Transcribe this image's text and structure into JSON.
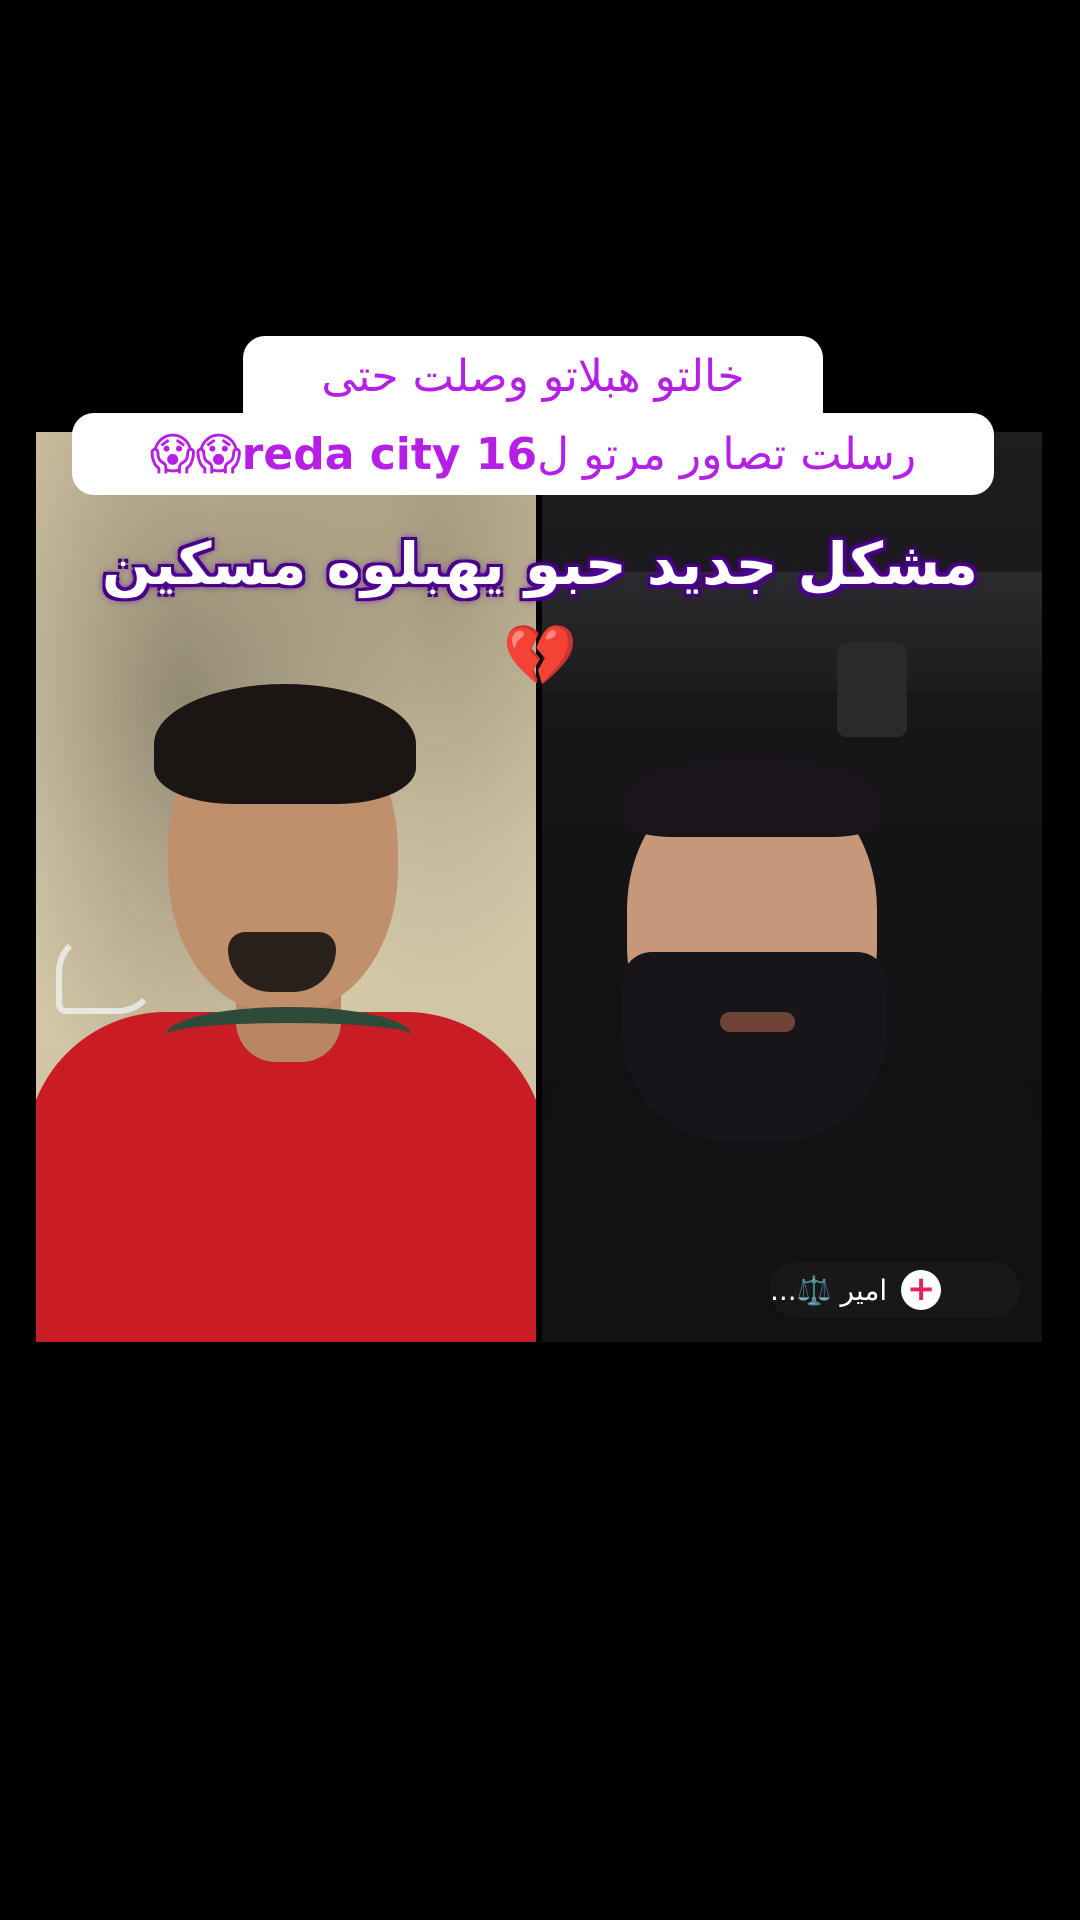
{
  "caption": {
    "line1": "خالتو هبلاتو وصلت حتى",
    "line2_prefix": "رسلت تصاور مرتو ل ",
    "line2_handle": "reda city 16",
    "line2_emoji": "😱😱"
  },
  "headline": {
    "text": "مشكل جديد حبو يهبلوه مسكين",
    "emoji": "💔"
  },
  "creator": {
    "name": "امير ⚖️...",
    "follow_label": "+"
  },
  "colors": {
    "caption_text": "#b51fe6",
    "headline_glow": "#5b00a8",
    "background": "#000000"
  }
}
